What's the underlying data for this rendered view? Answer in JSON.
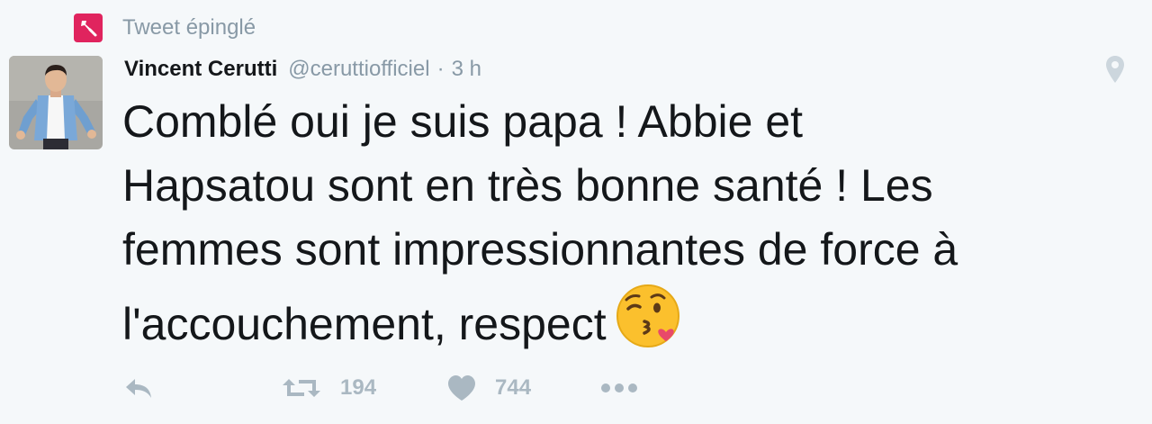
{
  "pinned": {
    "label": "Tweet épinglé"
  },
  "author": {
    "name": "Vincent Cerutti",
    "handle": "@ceruttiofficiel",
    "separator": "·",
    "time": "3 h"
  },
  "tweet": {
    "text": "Comblé oui je suis papa ! Abbie et\nHapsatou sont en très bonne santé ! Les\nfemmes sont impressionnantes de force à\nl'accouchement, respect",
    "emoji": "face-throwing-kiss-emoji"
  },
  "actions": {
    "retweet_count": "194",
    "like_count": "744"
  },
  "icons": {
    "pin": "pin-icon",
    "location": "location-icon",
    "reply": "reply-icon",
    "retweet": "retweet-icon",
    "like": "heart-icon",
    "more": "more-icon"
  },
  "colors": {
    "background": "#f5f8fa",
    "pin_red": "#e0245e",
    "muted": "#8899a6",
    "action_gray": "#aab8c2",
    "text": "#14171a"
  }
}
